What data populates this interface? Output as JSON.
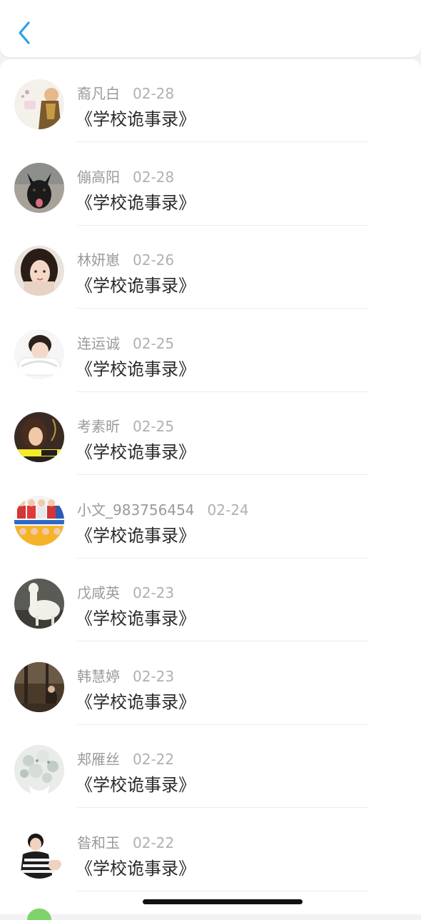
{
  "header": {
    "back_icon": "chevron-left-icon",
    "accent": "#2aa3e6"
  },
  "items": [
    {
      "name": "裔凡白",
      "date": "02-28",
      "title": "《学校诡事录》",
      "avatar": "cartoon"
    },
    {
      "name": "傰高阳",
      "date": "02-28",
      "title": "《学校诡事录》",
      "avatar": "dog"
    },
    {
      "name": "林妍崽",
      "date": "02-26",
      "title": "《学校诡事录》",
      "avatar": "girl-portrait"
    },
    {
      "name": "连运诚",
      "date": "02-25",
      "title": "《学校诡事录》",
      "avatar": "boy-pillow"
    },
    {
      "name": "考素昕",
      "date": "02-25",
      "title": "《学校诡事录》",
      "avatar": "girl-dark"
    },
    {
      "name": "小文_983756454",
      "date": "02-24",
      "title": "《学校诡事录》",
      "avatar": "group"
    },
    {
      "name": "戊咸英",
      "date": "02-23",
      "title": "《学校诡事录》",
      "avatar": "alpaca"
    },
    {
      "name": "韩慧婷",
      "date": "02-23",
      "title": "《学校诡事录》",
      "avatar": "forest"
    },
    {
      "name": "郏雁丝",
      "date": "02-22",
      "title": "《学校诡事录》",
      "avatar": "flowers"
    },
    {
      "name": "昝和玉",
      "date": "02-22",
      "title": "《学校诡事录》",
      "avatar": "boy-striped"
    }
  ]
}
